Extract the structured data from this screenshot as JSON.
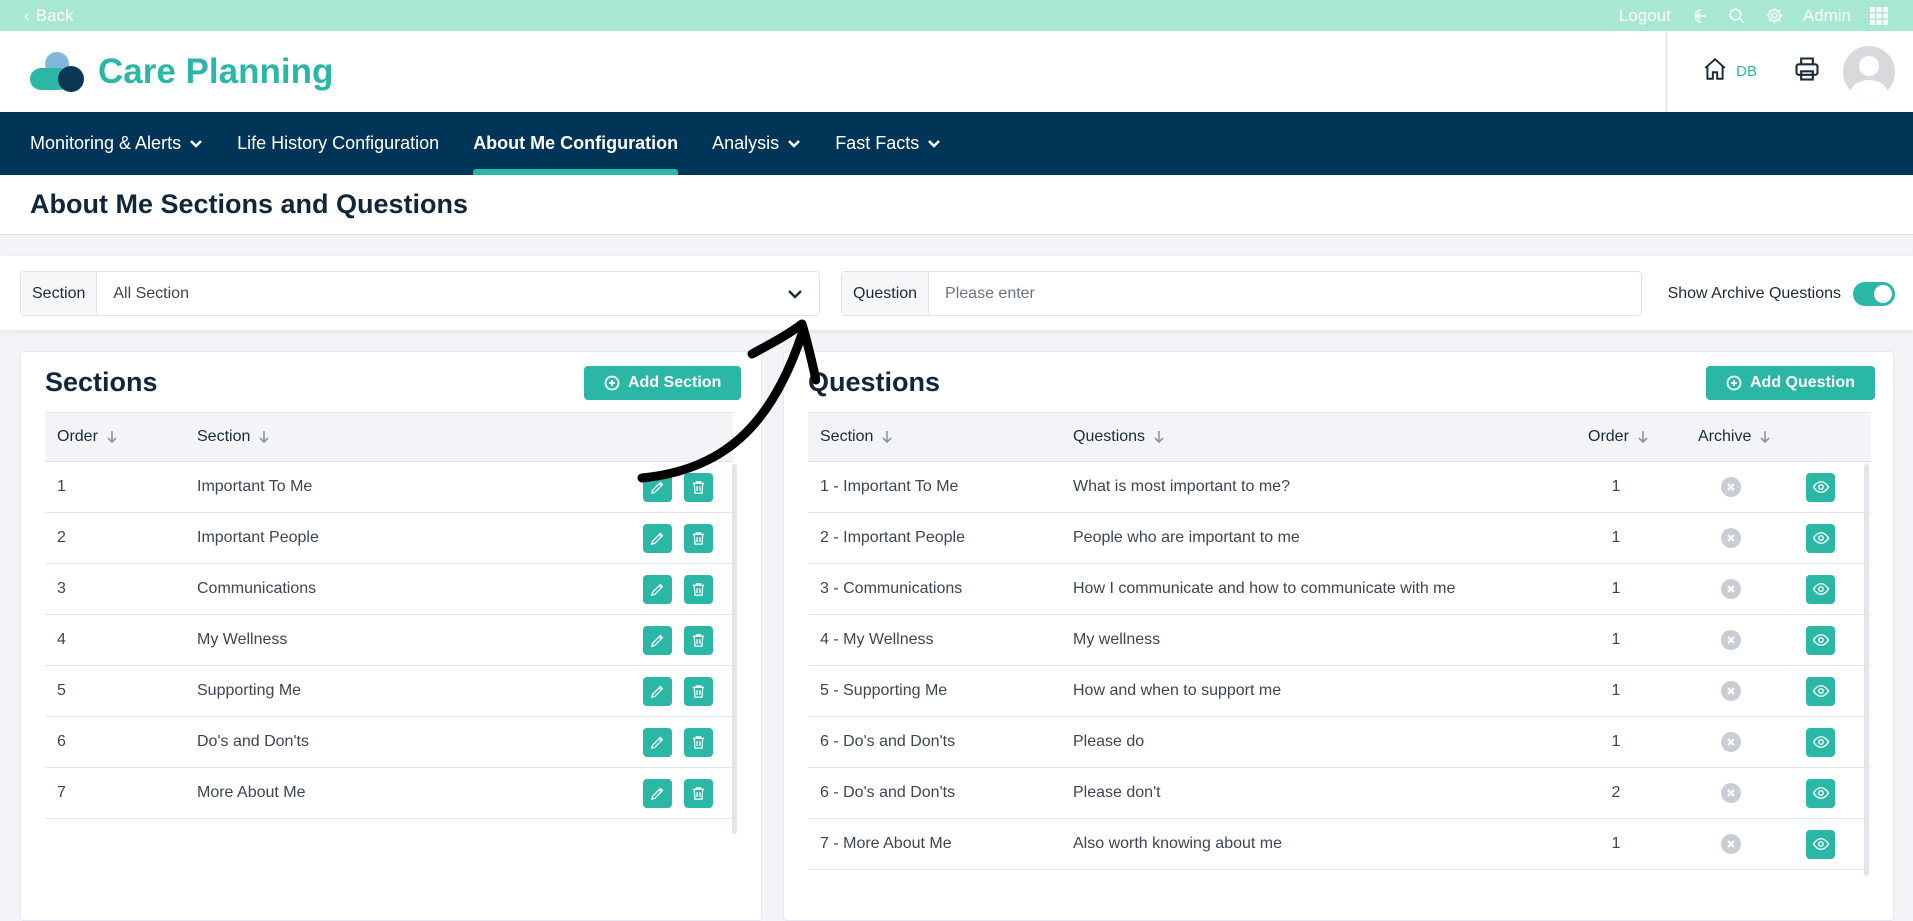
{
  "topbar": {
    "back_label": "Back",
    "logout_label": "Logout",
    "user_label": "Admin"
  },
  "header": {
    "app_title": "Care Planning",
    "db_label": "DB"
  },
  "nav": {
    "items": [
      {
        "label": "Monitoring & Alerts",
        "dropdown": true
      },
      {
        "label": "Life History Configuration",
        "dropdown": false
      },
      {
        "label": "About Me Configuration",
        "dropdown": false,
        "active": true
      },
      {
        "label": "Analysis",
        "dropdown": true
      },
      {
        "label": "Fast Facts",
        "dropdown": true
      }
    ]
  },
  "page": {
    "title": "About Me Sections and Questions"
  },
  "filters": {
    "section_label": "Section",
    "section_value": "All Section",
    "question_label": "Question",
    "question_placeholder": "Please enter",
    "archive_toggle_label": "Show Archive Questions",
    "archive_toggle_on": true
  },
  "sections_panel": {
    "title": "Sections",
    "add_button_label": "Add Section",
    "columns": [
      "Order",
      "Section"
    ],
    "rows": [
      {
        "order": "1",
        "section": "Important To Me"
      },
      {
        "order": "2",
        "section": "Important People"
      },
      {
        "order": "3",
        "section": "Communications"
      },
      {
        "order": "4",
        "section": "My Wellness"
      },
      {
        "order": "5",
        "section": "Supporting Me"
      },
      {
        "order": "6",
        "section": "Do's and Don'ts"
      },
      {
        "order": "7",
        "section": "More About Me"
      }
    ]
  },
  "questions_panel": {
    "title": "Questions",
    "add_button_label": "Add Question",
    "columns": [
      "Section",
      "Questions",
      "Order",
      "Archive"
    ],
    "rows": [
      {
        "section": "1 - Important To Me",
        "question": "What is most important to me?",
        "order": "1"
      },
      {
        "section": "2 - Important People",
        "question": "People who are important to me",
        "order": "1"
      },
      {
        "section": "3 - Communications",
        "question": "How I communicate and how to communicate with me",
        "order": "1"
      },
      {
        "section": "4 - My Wellness",
        "question": "My wellness",
        "order": "1"
      },
      {
        "section": "5 - Supporting Me",
        "question": "How and when to support me",
        "order": "1"
      },
      {
        "section": "6 - Do's and Don'ts",
        "question": "Please do",
        "order": "1"
      },
      {
        "section": "6 - Do's and Don'ts",
        "question": "Please don't",
        "order": "2"
      },
      {
        "section": "7 - More About Me",
        "question": "Also worth knowing about me",
        "order": "1"
      }
    ]
  },
  "colors": {
    "accent": "#2bb7a5",
    "nav_bg": "#003557",
    "topbar_bg": "#a8e8d0"
  }
}
